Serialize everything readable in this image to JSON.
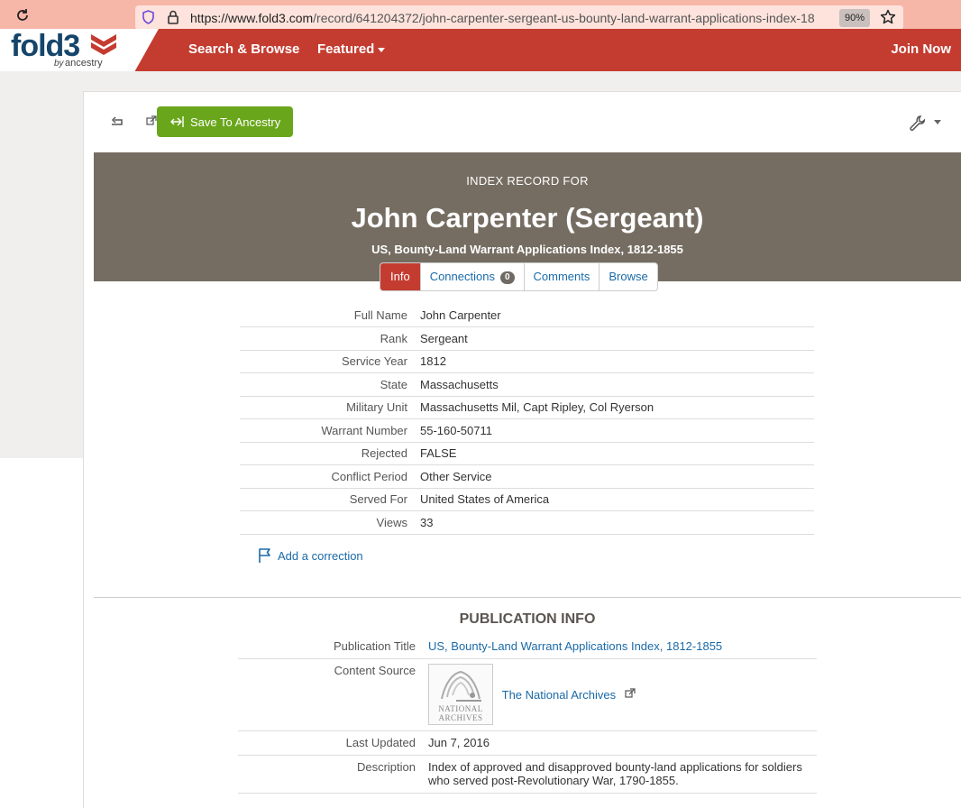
{
  "browser": {
    "url_host": "https://www.fold3.com",
    "url_path": "/record/641204372/john-carpenter-sergeant-us-bounty-land-warrant-applications-index-18",
    "zoom": "90%"
  },
  "header": {
    "logo_main": "fold3",
    "logo_by": "by",
    "logo_brand": "ancestry",
    "nav": {
      "search": "Search & Browse",
      "featured": "Featured"
    },
    "join": "Join Now",
    "colors": {
      "brand_red": "#c43c30",
      "logo_blue": "#16456b"
    }
  },
  "toolbar": {
    "save_label": "Save To Ancestry",
    "save_color": "#6aa61c"
  },
  "record": {
    "kicker": "INDEX RECORD FOR",
    "title": "John Carpenter (Sergeant)",
    "subtitle": "US, Bounty-Land Warrant Applications Index, 1812-1855",
    "banner_color": "#756d62"
  },
  "tabs": {
    "info": "Info",
    "connections": "Connections",
    "connections_count": "0",
    "comments": "Comments",
    "browse": "Browse"
  },
  "fields": [
    {
      "label": "Full Name",
      "value": "John Carpenter"
    },
    {
      "label": "Rank",
      "value": "Sergeant"
    },
    {
      "label": "Service Year",
      "value": "1812"
    },
    {
      "label": "State",
      "value": "Massachusetts"
    },
    {
      "label": "Military Unit",
      "value": "Massachusetts Mil, Capt Ripley, Col Ryerson"
    },
    {
      "label": "Warrant Number",
      "value": "55-160-50711"
    },
    {
      "label": "Rejected",
      "value": "FALSE"
    },
    {
      "label": "Conflict Period",
      "value": "Other Service"
    },
    {
      "label": "Served For",
      "value": "United States of America"
    },
    {
      "label": "Views",
      "value": "33"
    }
  ],
  "correction_label": "Add a correction",
  "publication": {
    "heading": "PUBLICATION INFO",
    "title_label": "Publication Title",
    "title_value": "US, Bounty-Land Warrant Applications Index, 1812-1855",
    "source_label": "Content Source",
    "source_logo_line1": "NATIONAL",
    "source_logo_line2": "ARCHIVES",
    "source_value": "The National Archives",
    "updated_label": "Last Updated",
    "updated_value": "Jun 7, 2016",
    "description_label": "Description",
    "description_value": "Index of approved and disapproved bounty-land applications for soldiers who served post-Revolutionary War, 1790-1855."
  }
}
